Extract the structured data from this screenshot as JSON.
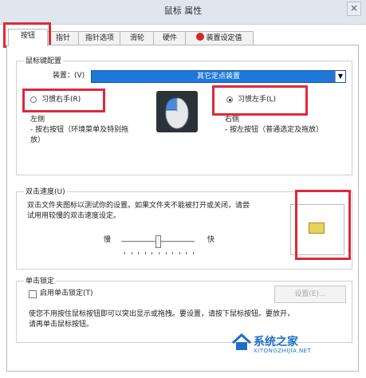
{
  "window": {
    "title": "鼠标 属性",
    "close": "×"
  },
  "tabs": [
    {
      "label": "按钮"
    },
    {
      "label": "指针"
    },
    {
      "label": "指针选项"
    },
    {
      "label": "滑轮"
    },
    {
      "label": "硬件"
    },
    {
      "label": "装置设定值"
    }
  ],
  "buttons_config": {
    "group_label": "鼠标键配置",
    "device_label": "装置：(V)",
    "device_value": "其它定点装置",
    "right_hand_label": "习惯右手(R)",
    "left_hand_label": "习惯左手(L)",
    "left_title": "左侧",
    "left_desc_1": "- 按右按钮（环境菜单及特别拖",
    "left_desc_2": "放）",
    "right_title": "右侧",
    "right_desc": "- 按左按钮（普通选定及拖放）",
    "selected": "left-hand"
  },
  "double_click": {
    "group_label": "双击速度(U)",
    "desc_1": "双击文件夹图标以测试你的设置。如果文件夹不能被打开或关闭，请尝",
    "desc_2": "试用用较慢的双击速度设定。",
    "slow_label": "慢",
    "fast_label": "快",
    "speed_fraction": 0.5
  },
  "click_lock": {
    "group_label": "单击锁定",
    "enable_label": "启用单击锁定(T)",
    "enabled": false,
    "settings_button": "设置(E)...",
    "desc_1": "使您不用按住鼠标按钮即可以突出显示或拖拽。要设置，请按下鼠标按钮。要放开，",
    "desc_2": "请再单击鼠标按钮。"
  },
  "watermark": {
    "text": "系统之家",
    "url_text": "XITONGZHIJIA.NET"
  },
  "colors": {
    "highlight_red": "#e0283a",
    "combo_blue": "#1f78d9"
  }
}
